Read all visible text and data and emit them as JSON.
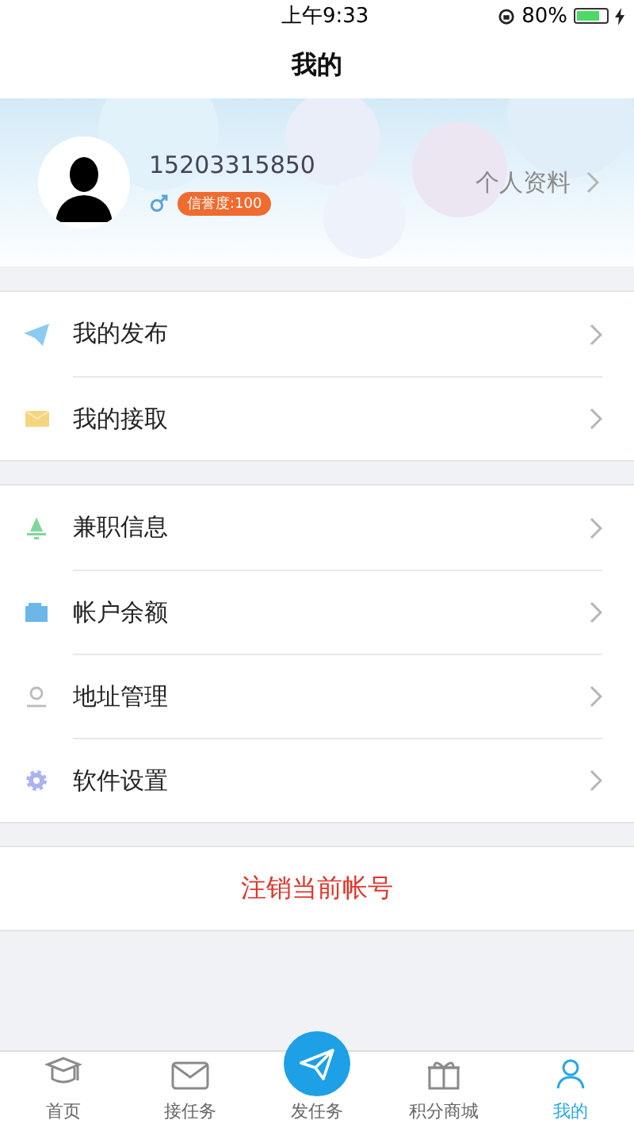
{
  "status_bar": {
    "time": "上午9:33",
    "battery": "80%"
  },
  "nav": {
    "title": "我的"
  },
  "profile": {
    "phone": "15203315850",
    "credit": "信誉度:100",
    "link": "个人资料"
  },
  "menu_groups": [
    [
      {
        "label": "我的发布"
      },
      {
        "label": "我的接取"
      }
    ],
    [
      {
        "label": "兼职信息"
      },
      {
        "label": "帐户余额"
      },
      {
        "label": "地址管理"
      },
      {
        "label": "软件设置"
      }
    ]
  ],
  "logout": "注销当前帐号",
  "tabs": [
    {
      "label": "首页",
      "selected": false,
      "kind": "normal"
    },
    {
      "label": "接任务",
      "selected": false,
      "kind": "normal"
    },
    {
      "label": "发任务",
      "selected": false,
      "kind": "raised"
    },
    {
      "label": "积分商城",
      "selected": false,
      "kind": "normal"
    },
    {
      "label": "我的",
      "selected": true,
      "kind": "normal"
    }
  ]
}
